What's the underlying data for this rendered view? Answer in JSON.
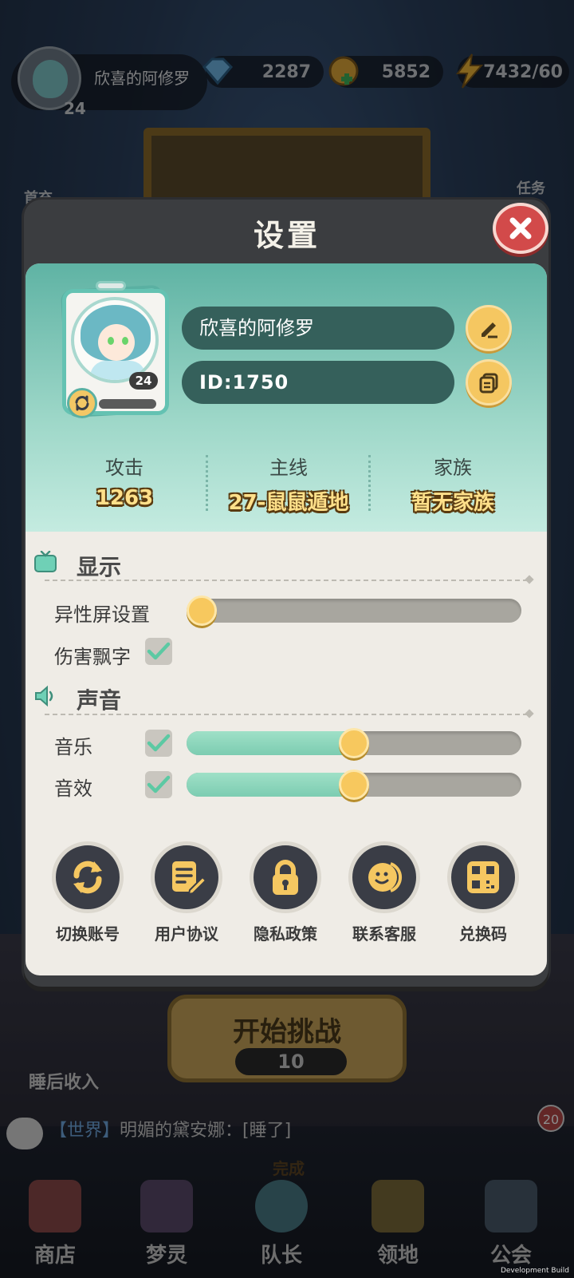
{
  "hud": {
    "player_name": "欣喜的阿修罗",
    "player_level": "24",
    "gems": "2287",
    "coins": "5852",
    "energy": "7432/60",
    "left_button": "首充",
    "right_button": "任务"
  },
  "settings": {
    "title": "设置",
    "profile": {
      "name": "欣喜的阿修罗",
      "id": "ID:1750",
      "level": "24"
    },
    "stats": [
      {
        "label": "攻击",
        "value": "1263"
      },
      {
        "label": "主线",
        "value": "27-鼠鼠遁地"
      },
      {
        "label": "家族",
        "value": "暂无家族"
      }
    ],
    "display_section": {
      "title": "显示",
      "rows": [
        {
          "label": "异性屏设置",
          "slider_level": 0.0
        },
        {
          "label": "伤害飘字",
          "checked": true
        }
      ]
    },
    "sound_section": {
      "title": "声音",
      "rows": [
        {
          "label": "音乐",
          "checked": true,
          "slider_level": 0.5
        },
        {
          "label": "音效",
          "checked": true,
          "slider_level": 0.5
        }
      ]
    },
    "actions": [
      {
        "label": "切换账号",
        "icon": "swap-account-icon"
      },
      {
        "label": "用户协议",
        "icon": "user-agreement-icon"
      },
      {
        "label": "隐私政策",
        "icon": "privacy-lock-icon"
      },
      {
        "label": "联系客服",
        "icon": "customer-service-icon"
      },
      {
        "label": "兑换码",
        "icon": "redeem-code-icon"
      }
    ]
  },
  "game": {
    "start_label": "开始挑战",
    "start_cost": "10",
    "sleep_label": "睡后收入",
    "chat_tag": "【世界】",
    "chat_message": "明媚的黛安娜：[睡了]",
    "chat_unread": "20",
    "done_label": "完成"
  },
  "nav": [
    {
      "label": "商店"
    },
    {
      "label": "梦灵"
    },
    {
      "label": "队长"
    },
    {
      "label": "领地"
    },
    {
      "label": "公会"
    }
  ],
  "footer": "Development Build",
  "colors": {
    "accent_teal": "#5fb3a4",
    "knob_yellow": "#f7c85e",
    "close_red": "#d24a4a",
    "panel_bg": "#efece6"
  }
}
